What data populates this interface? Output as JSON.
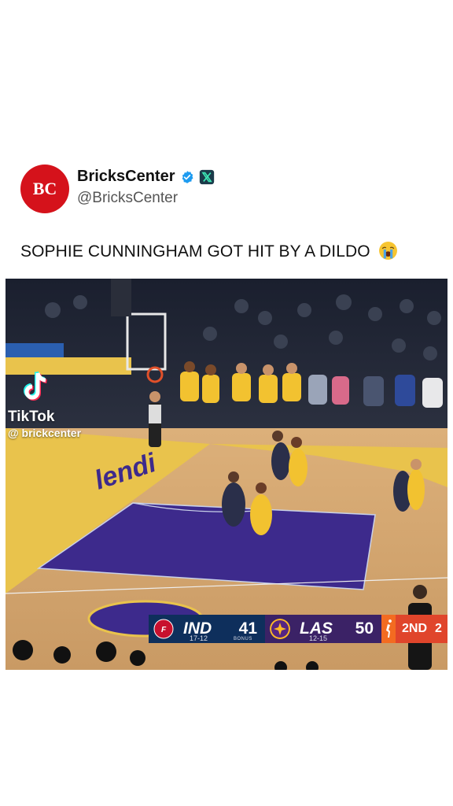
{
  "post": {
    "display_name": "BricksCenter",
    "handle": "@BricksCenter",
    "avatar_text": "BC",
    "caption": "SOPHIE CUNNINGHAM GOT HIT BY A DILDO",
    "caption_emoji": "loudly-crying-face-emoji"
  },
  "video": {
    "court_text": "lendi",
    "tiktok": {
      "brand": "TikTok",
      "user": "@ brickcenter"
    },
    "scorebug": {
      "home_team": "IND",
      "home_score": "41",
      "home_record": "17-12",
      "home_bonus": "BONUS",
      "away_team": "LAS",
      "away_score": "50",
      "away_record": "12-15",
      "period": "2ND",
      "period_extra": "2"
    }
  },
  "colors": {
    "avatar_red": "#d5121b",
    "verified_blue": "#1d9bf0",
    "court_purple": "#3d2a8c",
    "court_gold": "#e9c34c",
    "fever_navy": "#0e2f5c",
    "sparks_purple": "#3b2266",
    "period_orange": "#e0452b"
  }
}
